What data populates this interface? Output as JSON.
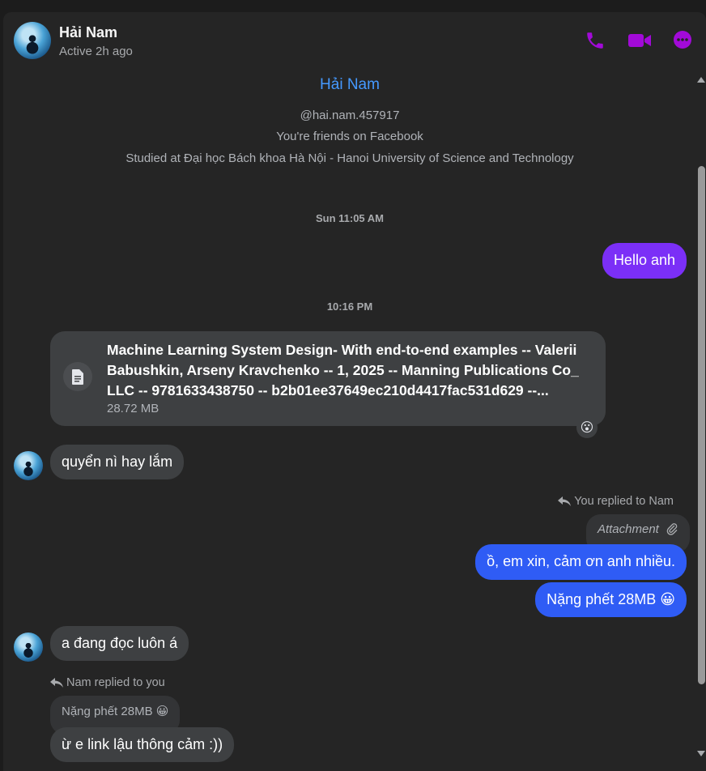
{
  "header": {
    "name": "Hải Nam",
    "status": "Active 2h ago",
    "accent": "#a20ad8"
  },
  "profile": {
    "name": "Hải Nam",
    "username": "@hai.nam.457917",
    "friends": "You're friends on Facebook",
    "studied": "Studied at Đại học Bách khoa Hà Nội - Hanoi University of Science and Technology"
  },
  "timestamps": [
    "Sun 11:05 AM",
    "10:16 PM"
  ],
  "messages": {
    "m1": "Hello anh",
    "file": {
      "title": "Machine Learning System Design- With end-to-end examples -- Valerii Babushkin, Arseny Kravchenko -- 1, 2025 -- Manning Publications Co_ LLC -- 9781633438750 -- b2b01ee37649ec210d4417fac531d629 --...",
      "size": "28.72 MB",
      "reaction": "😮"
    },
    "m2": "quyển nì hay lắm",
    "reply1": {
      "label": "You replied to Nam",
      "quoted": "Attachment"
    },
    "m3": "ồ, em xin, cảm ơn anh nhiều.",
    "m4": "Nặng phết 28MB 😀",
    "m5": "a đang đọc luôn á",
    "reply2": {
      "label": "Nam replied to you",
      "quoted": "Nặng phết 28MB 😀"
    },
    "m6": "ừ e link lậu thông cảm :))"
  },
  "colors": {
    "sent_purple": "#7b2ff7",
    "sent_blue": "#2f5cf5",
    "received": "#3e4042",
    "profile_name": "#4599ff"
  }
}
